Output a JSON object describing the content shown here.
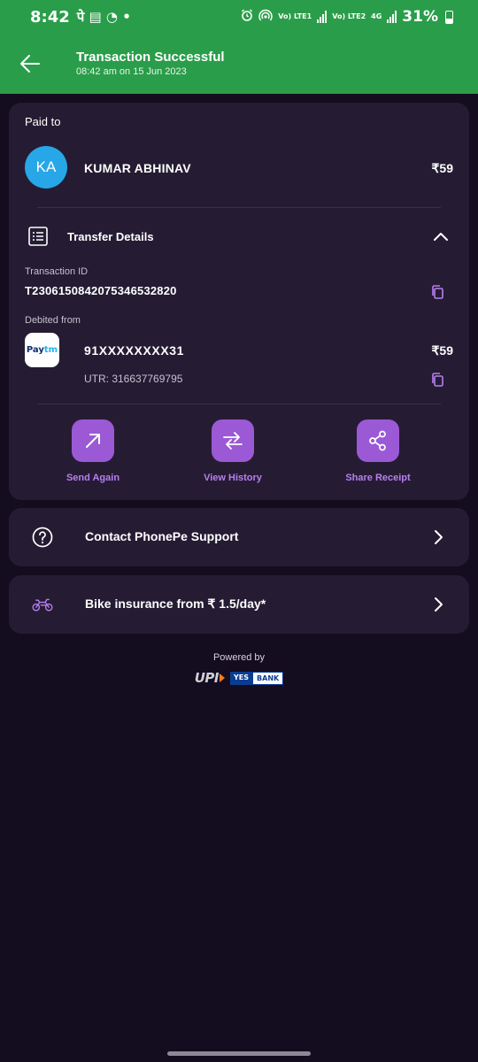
{
  "status_bar": {
    "time": "8:42",
    "left_glyphs": "पे ▤ ◔ •",
    "lte1": "Vo) LTE1",
    "lte2": "Vo) LTE2",
    "net": "4G",
    "battery": "31%"
  },
  "header": {
    "title": "Transaction Successful",
    "subtitle": "08:42 am on 15 Jun 2023"
  },
  "payment": {
    "paid_to_label": "Paid to",
    "avatar_initials": "KA",
    "payee_name": "KUMAR ABHINAV",
    "amount": "₹59"
  },
  "transfer_details": {
    "label": "Transfer Details",
    "transaction_id_label": "Transaction ID",
    "transaction_id": "T2306150842075346532820",
    "debited_from_label": "Debited from",
    "bank_logo_pay": "Pay",
    "bank_logo_tm": "tm",
    "account": "91XXXXXXXX31",
    "account_amount": "₹59",
    "utr": "UTR: 316637769795"
  },
  "actions": [
    {
      "label": "Send Again"
    },
    {
      "label": "View History"
    },
    {
      "label": "Share Receipt"
    }
  ],
  "support": {
    "label": "Contact PhonePe Support"
  },
  "offer": {
    "label": "Bike insurance from ₹ 1.5/day*"
  },
  "footer": {
    "powered_by": "Powered by",
    "upi": "UPI",
    "bank_yes": "YES",
    "bank_bank": "BANK"
  },
  "colors": {
    "header_green": "#2a9d4a",
    "accent_purple": "#9b59d6",
    "card_bg": "#251c33",
    "page_bg": "#140c1f"
  }
}
